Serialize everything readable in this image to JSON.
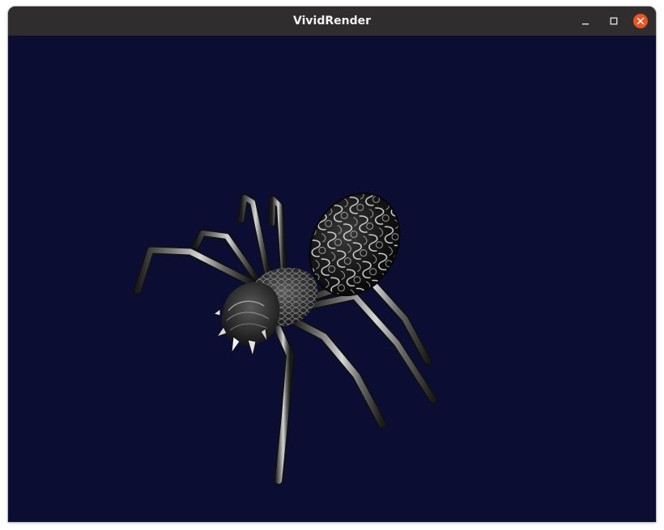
{
  "window": {
    "title": "VividRender",
    "controls": {
      "minimize_icon": "minimize-icon",
      "maximize_icon": "maximize-icon",
      "close_icon": "close-icon"
    },
    "colors": {
      "titlebar": "#2f2d2d",
      "title_text": "#f2f2f2",
      "close_button": "#e95420"
    }
  },
  "viewport": {
    "background": "#0c0d33",
    "content": "spider-model"
  }
}
